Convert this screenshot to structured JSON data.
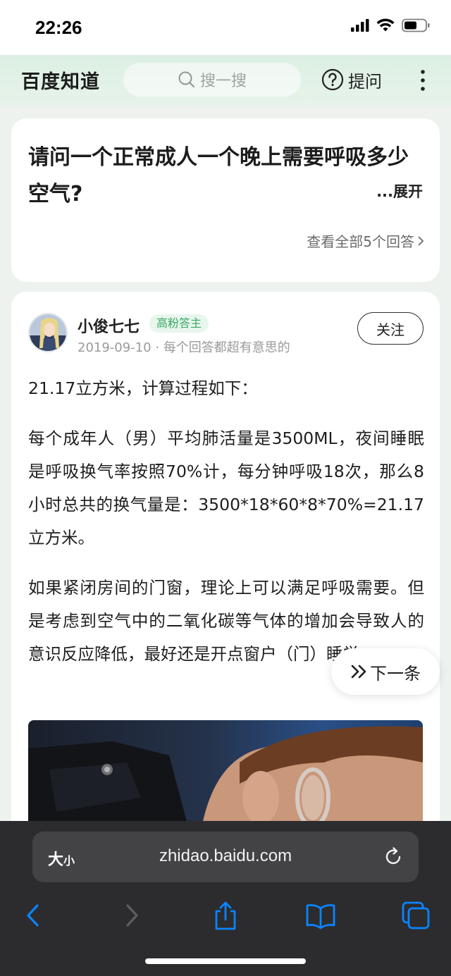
{
  "status_bar": {
    "time": "22:26"
  },
  "header": {
    "logo": "百度知道",
    "search_placeholder": "搜一搜",
    "ask_label": "提问"
  },
  "question": {
    "title": "请问一个正常成人一个晚上需要呼吸多少空气?",
    "expand_label": "...展开",
    "view_all_label": "查看全部5个回答"
  },
  "answer": {
    "author_name": "小俊七七",
    "author_badge": "高粉答主",
    "date": "2019-09-10",
    "separator": "·",
    "tagline": "每个回答都超有意思的",
    "follow_label": "关注",
    "paragraphs": [
      "21.17立方米，计算过程如下：",
      "每个成年人（男）平均肺活量是3500ML，夜间睡眠是呼吸换气率按照70%计，每分钟呼吸18次，那么8小时总共的换气量是：3500*18*60*8*70%=21.17立方米。",
      "如果紧闭房间的门窗，理论上可以满足呼吸需要。但是考虑到空气中的二氧化碳等气体的增加会导致人的意识反应降低，最好还是开点窗户（门）睡觉。"
    ]
  },
  "next_button": {
    "label": "下一条"
  },
  "browser": {
    "font_size_big": "大",
    "font_size_small": "小",
    "url": "zhidao.baidu.com"
  },
  "colors": {
    "header_bg": "#dcefe3",
    "badge_green": "#3aa862",
    "browser_bar": "#2c2c2e",
    "toolbar_blue": "#0a84ff"
  }
}
